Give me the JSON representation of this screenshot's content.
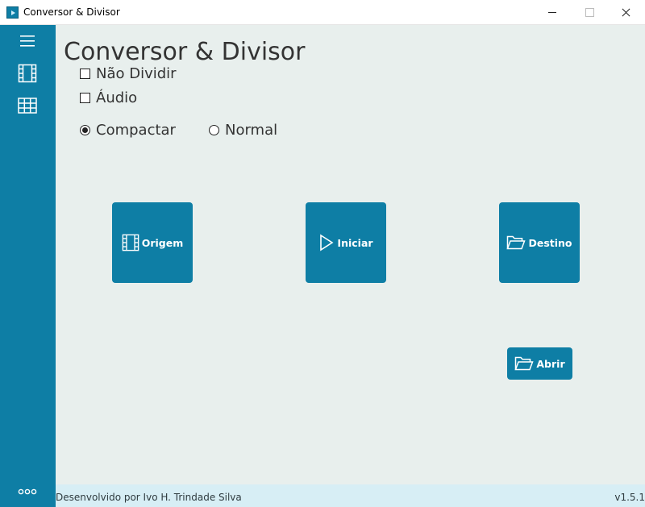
{
  "window": {
    "title": "Conversor & Divisor",
    "icon": "play-app-icon",
    "controls": [
      "minimize-icon",
      "maximize-icon",
      "close-icon"
    ]
  },
  "sidebar": {
    "items": [
      {
        "icon": "hamburger-menu-icon"
      },
      {
        "icon": "film-icon"
      },
      {
        "icon": "grid-icon"
      }
    ],
    "more_label": "ooo"
  },
  "main": {
    "title": "Conversor & Divisor",
    "options": {
      "nao_dividir": {
        "label": "Não Dividir",
        "checked": false
      },
      "audio": {
        "label": "Áudio",
        "checked": false
      }
    },
    "mode": {
      "compactar": {
        "label": "Compactar",
        "selected": true
      },
      "normal": {
        "label": "Normal",
        "selected": false
      }
    },
    "buttons": {
      "origem": {
        "label": "Origem",
        "icon": "film-icon"
      },
      "iniciar": {
        "label": "Iniciar",
        "icon": "play-icon"
      },
      "destino": {
        "label": "Destino",
        "icon": "folder-open-icon"
      },
      "abrir": {
        "label": "Abrir",
        "icon": "folder-open-icon"
      }
    }
  },
  "footer": {
    "developer": "Desenvolvido por Ivo H. Trindade Silva",
    "version": "v1.5.1"
  },
  "colors": {
    "accent": "#0e7ea5",
    "content_bg": "#e8efed",
    "footer_bg": "#d7eef5",
    "text": "#333333"
  }
}
